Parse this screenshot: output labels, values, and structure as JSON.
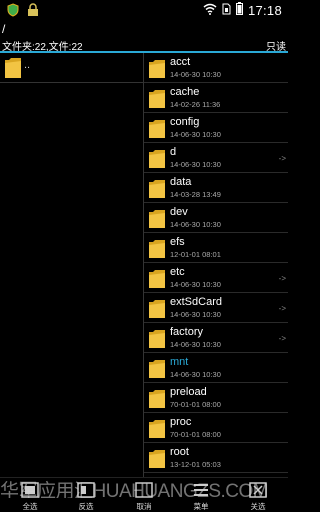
{
  "status_bar": {
    "time": "17:18",
    "icons": [
      "shield-icon",
      "lock-icon",
      "wifi-icon",
      "sim-icon",
      "battery-icon"
    ]
  },
  "header": {
    "path": "/",
    "counts": "文件夹:22,文件:22",
    "mode": "只读"
  },
  "left_pane": {
    "up_label": ".."
  },
  "right_pane": {
    "items": [
      {
        "name": "acct",
        "date": "14-06-30 10:30",
        "link": ""
      },
      {
        "name": "cache",
        "date": "14-02-26 11:36",
        "link": ""
      },
      {
        "name": "config",
        "date": "14-06-30 10:30",
        "link": ""
      },
      {
        "name": "d",
        "date": "14-06-30 10:30",
        "link": "->"
      },
      {
        "name": "data",
        "date": "14-03-28 13:49",
        "link": ""
      },
      {
        "name": "dev",
        "date": "14-06-30 10:30",
        "link": ""
      },
      {
        "name": "efs",
        "date": "12-01-01 08:01",
        "link": ""
      },
      {
        "name": "etc",
        "date": "14-06-30 10:30",
        "link": "->"
      },
      {
        "name": "extSdCard",
        "date": "14-06-30 10:30",
        "link": "->"
      },
      {
        "name": "factory",
        "date": "14-06-30 10:30",
        "link": "->"
      },
      {
        "name": "mnt",
        "date": "14-06-30 10:30",
        "link": ""
      },
      {
        "name": "preload",
        "date": "70-01-01 08:00",
        "link": ""
      },
      {
        "name": "proc",
        "date": "70-01-01 08:00",
        "link": ""
      },
      {
        "name": "root",
        "date": "13-12-01 05:03",
        "link": ""
      }
    ],
    "highlight_color": "#2aa9d6"
  },
  "toolbar": {
    "buttons": [
      {
        "label": "全选",
        "icon": "select-all-icon"
      },
      {
        "label": "反选",
        "icon": "invert-selection-icon"
      },
      {
        "label": "取消",
        "icon": "cancel-icon"
      },
      {
        "label": "菜单",
        "icon": "menu-icon"
      },
      {
        "label": "关选",
        "icon": "close-selection-icon"
      }
    ]
  },
  "watermark": "华军应用汇HUAHUANGZS.COM",
  "colors": {
    "accent": "#2aa9d6",
    "folder": "#f0c24a",
    "background": "#000000"
  }
}
